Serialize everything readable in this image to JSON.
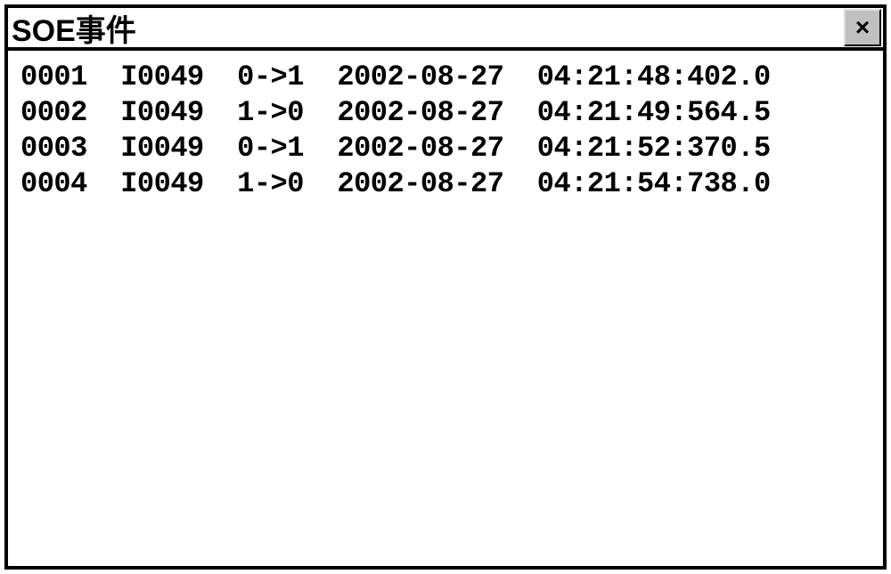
{
  "window": {
    "title": "SOE事件",
    "close_label": "×"
  },
  "events": [
    {
      "seq": "0001",
      "tag": "I0049",
      "transition": "0->1",
      "date": "2002-08-27",
      "time": "04:21:48:402.0"
    },
    {
      "seq": "0002",
      "tag": "I0049",
      "transition": "1->0",
      "date": "2002-08-27",
      "time": "04:21:49:564.5"
    },
    {
      "seq": "0003",
      "tag": "I0049",
      "transition": "0->1",
      "date": "2002-08-27",
      "time": "04:21:52:370.5"
    },
    {
      "seq": "0004",
      "tag": "I0049",
      "transition": "1->0",
      "date": "2002-08-27",
      "time": "04:21:54:738.0"
    }
  ]
}
